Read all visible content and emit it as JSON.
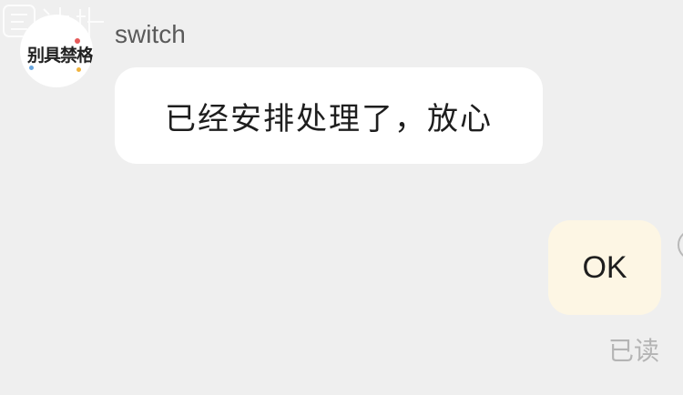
{
  "chat": {
    "incoming": {
      "sender_name": "switch",
      "avatar_logo_text": "别具禁格",
      "message": "已经安排处理了，放心"
    },
    "outgoing": {
      "message": "OK",
      "status": "已读"
    }
  },
  "colors": {
    "background": "#efefef",
    "incoming_bubble": "#ffffff",
    "outgoing_bubble": "#fdf6e4",
    "status_text": "#b4b4b4"
  },
  "icons": {
    "watermark": "site-watermark-icon",
    "avatar": "avatar-logo"
  }
}
